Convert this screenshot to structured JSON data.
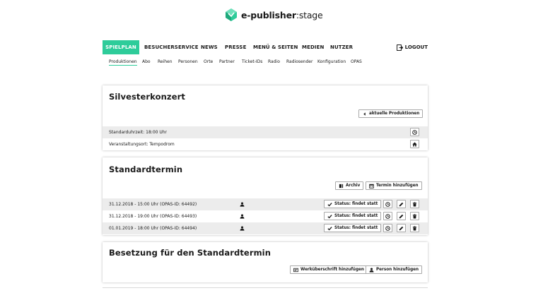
{
  "brand": {
    "name_bold": "e-publisher",
    "name_sep": ":",
    "name_light": "stage",
    "accent": "#2ecc9a"
  },
  "nav": {
    "items": [
      "SPIELPLAN",
      "BESUCHERSERVICE",
      "NEWS",
      "PRESSE",
      "MENÜ & SEITEN",
      "MEDIEN",
      "NUTZER"
    ],
    "active": "SPIELPLAN",
    "logout": "LOGOUT"
  },
  "subnav": {
    "items": [
      "Produktionen",
      "Abo",
      "Reihen",
      "Personen",
      "Orte",
      "Partner",
      "Ticket-IDs",
      "Radio",
      "Radiosender",
      "Konfiguration",
      "OPAS"
    ],
    "active": "Produktionen"
  },
  "production": {
    "title": "Silvesterkonzert",
    "back_button": "aktuelle Produktionen",
    "rows": [
      {
        "text": "Standarduhrzeit: 18:00 Uhr",
        "icon": "clock-icon"
      },
      {
        "text": "Veranstaltungsort: Tempodrom",
        "icon": "home-icon"
      }
    ]
  },
  "standardtermin": {
    "title": "Standardtermin",
    "archive_button": "Archiv",
    "add_button": "Termin hinzufügen",
    "status_label": "Status: findet statt",
    "rows": [
      "31.12.2018 - 15:00 Uhr (OPAS-ID: 64492)",
      "31.12.2018 - 19:00 Uhr (OPAS-ID: 64493)",
      "01.01.2019 - 18:00 Uhr (OPAS-ID: 64494)"
    ]
  },
  "besetzung": {
    "title": "Besetzung für den Standardtermin",
    "work_heading_button": "Werküberschrift hinzufügen",
    "add_person_button": "Person hinzufügen"
  }
}
